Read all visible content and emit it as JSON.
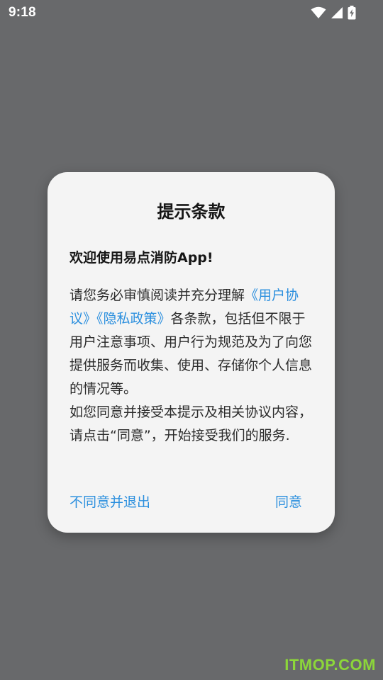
{
  "status_bar": {
    "time": "9:18",
    "icons": [
      "wifi-icon",
      "cell-signal-icon",
      "battery-charging-icon"
    ]
  },
  "dialog": {
    "title": "提示条款",
    "subtitle": "欢迎使用易点消防App!",
    "body": {
      "intro": "请您务必审慎阅读并充分理解",
      "link_user_agreement": "《用户协议》",
      "link_privacy_policy": "《隐私政策》",
      "terms": "各条款，包括但不限于用户注意事项、用户行为规范及为了向您提供服务而收集、使用、存储你个人信息的情况等。",
      "consent": "如您同意并接受本提示及相关协议内容，请点击“同意”，开始接受我们的服务."
    },
    "buttons": {
      "decline": "不同意并退出",
      "agree": "同意"
    }
  },
  "watermark": "ITMOP.COM",
  "colors": {
    "overlay": "#68696b",
    "dialog_bg": "#f4f4f4",
    "link": "#2b8fde",
    "watermark": "#8cd63a"
  }
}
